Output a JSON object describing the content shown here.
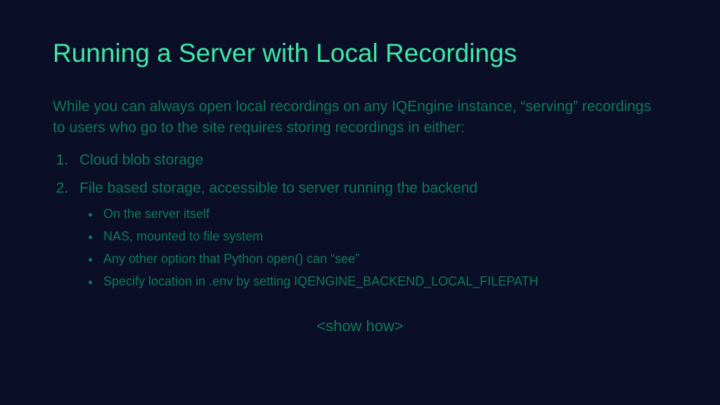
{
  "title": "Running a Server with Local Recordings",
  "intro": "While you can always open local recordings on any IQEngine instance, “serving” recordings to users who go to the site requires storing recordings in either:",
  "options": {
    "item1": "Cloud blob storage",
    "item2": "File based storage, accessible to server running the backend",
    "sub1": "On the server itself",
    "sub2": "NAS, mounted to file system",
    "sub3": "Any other option that Python open() can “see”",
    "sub4": "Specify location in .env by setting IQENGINE_BACKEND_LOCAL_FILEPATH"
  },
  "footer": "<show how>"
}
